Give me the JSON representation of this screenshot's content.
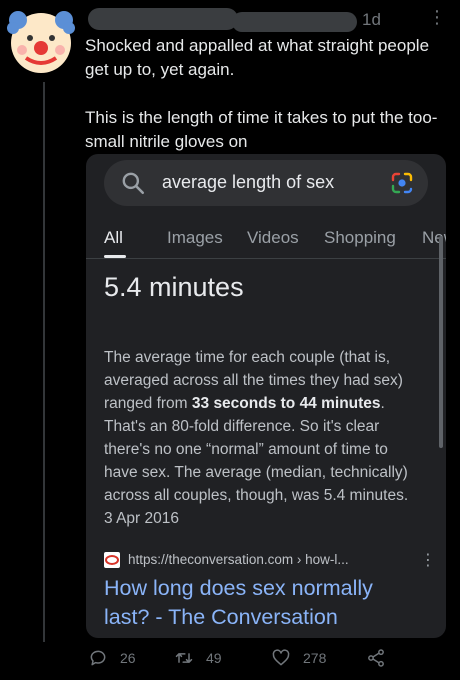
{
  "tweet": {
    "timestamp": "1d",
    "text": "Shocked and appalled at what straight people get up to, yet again.\n\nThis is the length of time it takes to put the too-small nitrile gloves on",
    "replies": "26",
    "retweets": "49",
    "likes": "278"
  },
  "search": {
    "query": "average length of sex",
    "tabs": [
      "All",
      "Images",
      "Videos",
      "Shopping",
      "News"
    ],
    "active_tab": "All",
    "answer": "5.4 minutes",
    "snippet_before": "The average time for each couple (that is, averaged across all the times they had sex) ranged from ",
    "snippet_bold": "33 seconds to 44 minutes",
    "snippet_after": ". That's an 80-fold difference. So it's clear there's no one “normal” amount of time to have sex. The average (median, technically) across all couples, though, was 5.4 minutes.",
    "date": "3 Apr 2016",
    "source_url": "https://theconversation.com › how-l...",
    "result_title": "How long does sex normally last? - The Conversation"
  },
  "icons": {
    "avatar": "clown-face-icon",
    "search": "search-icon",
    "lens": "google-lens-icon",
    "favicon": "theconversation-favicon",
    "reply": "reply-icon",
    "retweet": "retweet-icon",
    "like": "heart-icon",
    "share": "share-icon"
  },
  "colors": {
    "background": "#000000",
    "card": "#202124",
    "link": "#8ab4f8",
    "muted": "#71767b"
  }
}
